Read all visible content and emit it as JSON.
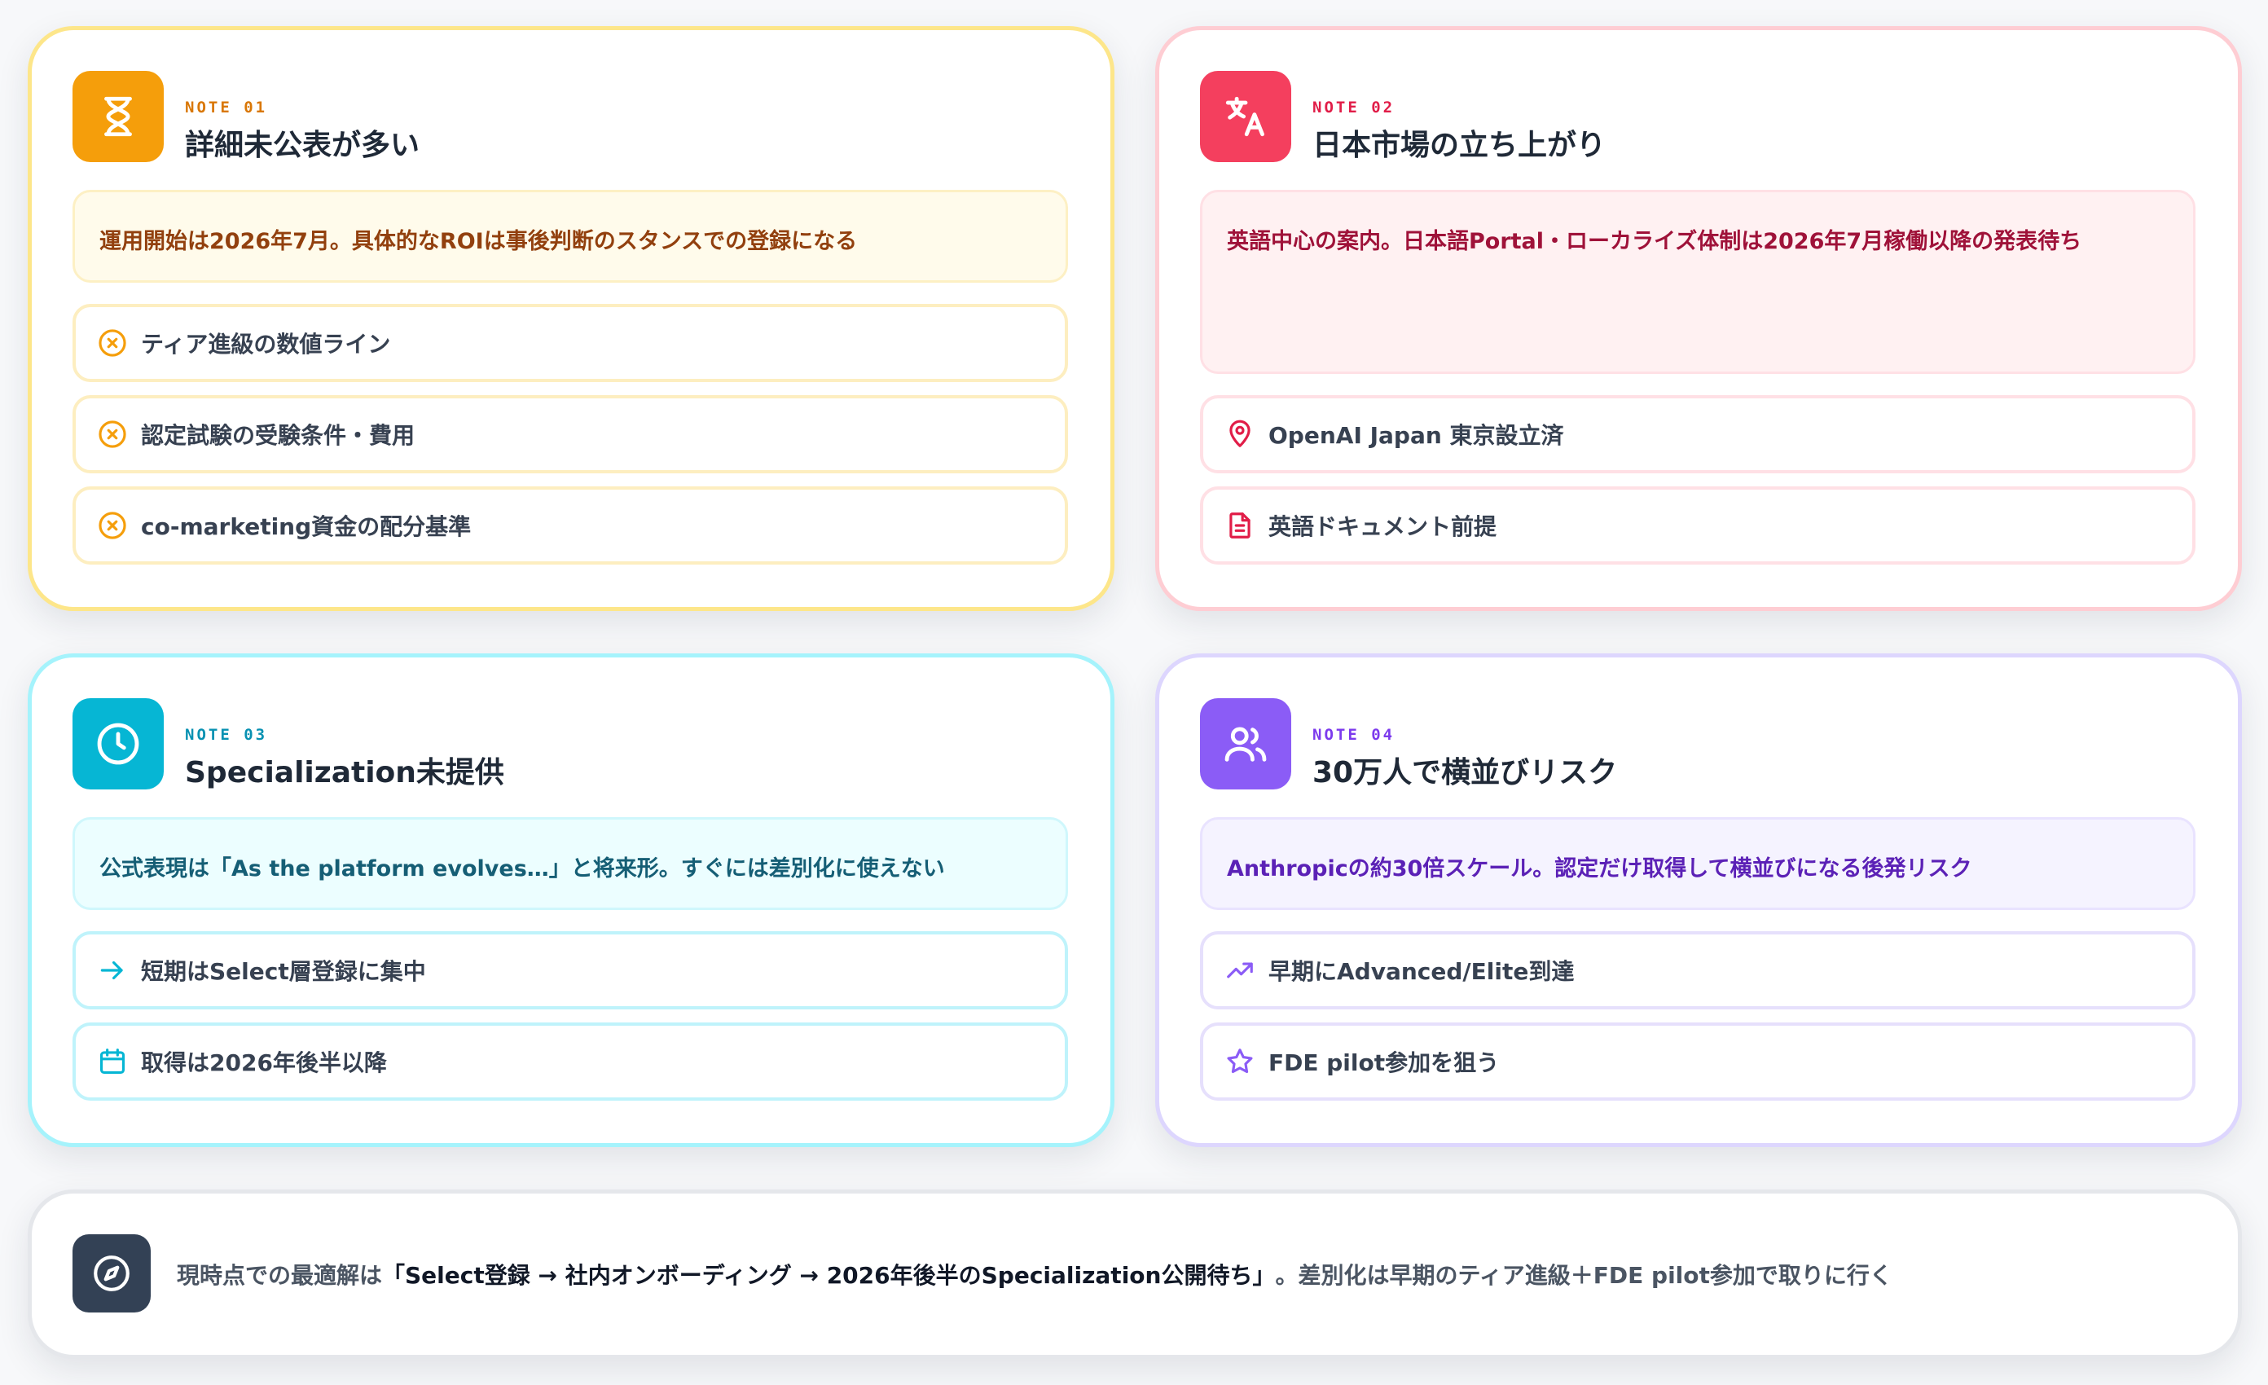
{
  "cards": [
    {
      "note": "NOTE 01",
      "title": "詳細未公表が多い",
      "icon": "hourglass-icon",
      "summary": "運用開始は2026年7月。具体的なROIは事後判断のスタンスでの登録になる",
      "items": [
        {
          "icon": "x-circle-icon",
          "label": "ティア進級の数値ライン"
        },
        {
          "icon": "x-circle-icon",
          "label": "認定試験の受験条件・費用"
        },
        {
          "icon": "x-circle-icon",
          "label": "co-marketing資金の配分基準"
        }
      ]
    },
    {
      "note": "NOTE 02",
      "title": "日本市場の立ち上がり",
      "icon": "translate-icon",
      "summary": "英語中心の案内。日本語Portal・ローカライズ体制は2026年7月稼働以降の発表待ち",
      "items": [
        {
          "icon": "map-pin-icon",
          "label": "OpenAI Japan 東京設立済"
        },
        {
          "icon": "document-icon",
          "label": "英語ドキュメント前提"
        }
      ]
    },
    {
      "note": "NOTE 03",
      "title": "Specialization未提供",
      "icon": "clock-icon",
      "summary": "公式表現は「As the platform evolves…」と将来形。すぐには差別化に使えない",
      "items": [
        {
          "icon": "arrow-right-icon",
          "label": "短期はSelect層登録に集中"
        },
        {
          "icon": "calendar-icon",
          "label": "取得は2026年後半以降"
        }
      ]
    },
    {
      "note": "NOTE 04",
      "title": "30万人で横並びリスク",
      "icon": "users-icon",
      "summary": "Anthropicの約30倍スケール。認定だけ取得して横並びになる後発リスク",
      "items": [
        {
          "icon": "trending-up-icon",
          "label": "早期にAdvanced/Elite到達"
        },
        {
          "icon": "star-icon",
          "label": "FDE pilot参加を狙う"
        }
      ]
    }
  ],
  "footer": {
    "icon": "compass-icon",
    "lead": "現時点での最適解は",
    "highlight": "「Select登録 → 社内オンボーディング → 2026年後半のSpecialization公開待ち」",
    "tail": "。差別化は早期のティア進級＋FDE pilot参加で取りに行く"
  }
}
